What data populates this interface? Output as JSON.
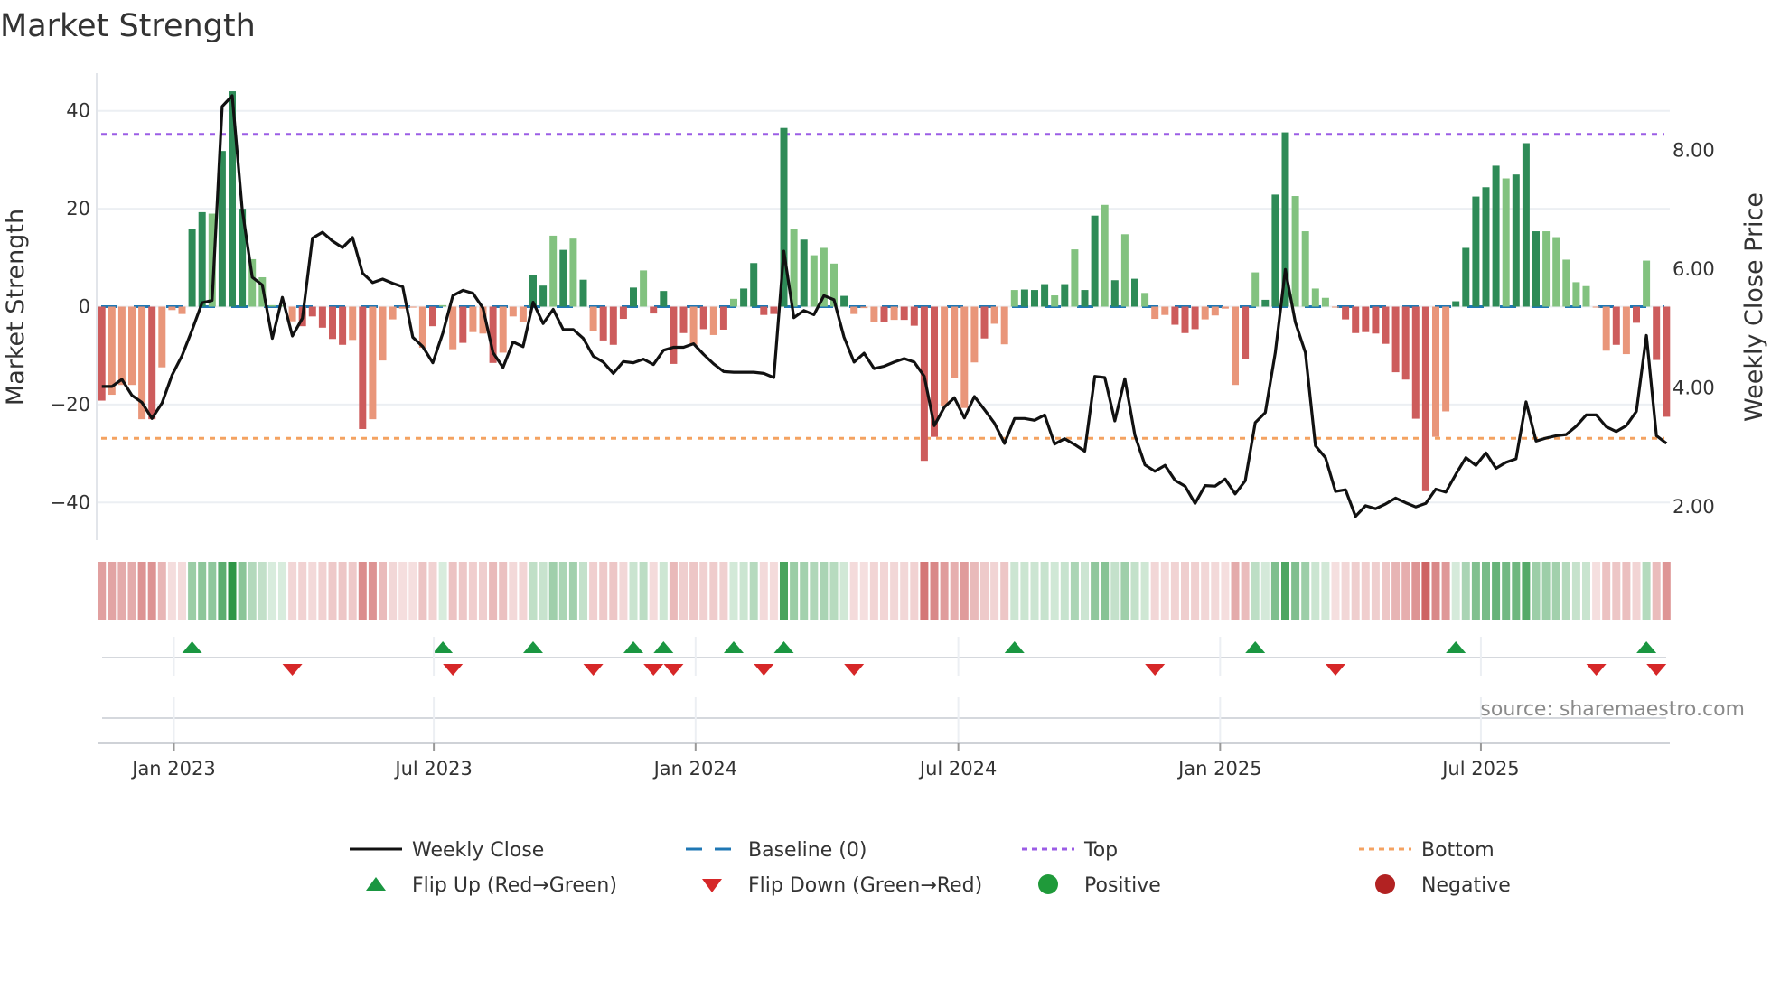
{
  "title": "Market Strength",
  "source": "source: sharemaestro.com",
  "chart_data": {
    "type": "bar+line",
    "title": "Market Strength",
    "ylabel_left": "Market Strength",
    "ylabel_right": "Weekly Close Price",
    "ylim_left": [
      -47.7,
      47.7
    ],
    "ylim_right": [
      1.42,
      9.29
    ],
    "yticks_left": [
      {
        "v": 40,
        "label": "40"
      },
      {
        "v": 20,
        "label": "20"
      },
      {
        "v": 0,
        "label": "0"
      },
      {
        "v": -20,
        "label": "−20"
      },
      {
        "v": -40,
        "label": "−40"
      }
    ],
    "yticks_right": [
      {
        "v": 8,
        "label": "8.00"
      },
      {
        "v": 6,
        "label": "6.00"
      },
      {
        "v": 4,
        "label": "4.00"
      },
      {
        "v": 2,
        "label": "2.00"
      }
    ],
    "xticks": [
      {
        "week": 7.19,
        "label": "Jan 2023"
      },
      {
        "week": 33.1,
        "label": "Jul 2023"
      },
      {
        "week": 59.2,
        "label": "Jan 2024"
      },
      {
        "week": 85.4,
        "label": "Jul 2024"
      },
      {
        "week": 111.5,
        "label": "Jan 2025"
      },
      {
        "week": 137.5,
        "label": "Jul 2025"
      }
    ],
    "top_level": 35.2,
    "bottom_level": -26.9,
    "baseline": 0,
    "strength": [
      -19.2,
      -18,
      -16,
      -16,
      -23,
      -23,
      -12.4,
      -0.7,
      -1.5,
      15.9,
      19.3,
      19,
      31.8,
      44,
      20,
      9.7,
      6,
      0.3,
      0.3,
      -3,
      -4,
      -2,
      -4.3,
      -6.6,
      -7.8,
      -6.8,
      -25,
      -23,
      -11,
      -2.6,
      -0.4,
      -0.2,
      -8.4,
      -4,
      0.3,
      -8.7,
      -7.4,
      -5.2,
      -5.5,
      -11.5,
      -9.4,
      -2,
      -3.2,
      6.4,
      4.3,
      14.5,
      11.6,
      13.9,
      5.5,
      -4.9,
      -6.9,
      -7.8,
      -2.5,
      3.9,
      7.4,
      -1.4,
      3.2,
      -11.7,
      -5.4,
      -7.8,
      -4.6,
      -5.8,
      -4.7,
      1.6,
      3.7,
      8.9,
      -1.7,
      -1.5,
      36.5,
      15.8,
      13.7,
      10.5,
      12,
      8.8,
      2.2,
      -1.5,
      -0.3,
      -3.1,
      -3.2,
      -2.7,
      -2.7,
      -3.9,
      -31.5,
      -26.6,
      -20.3,
      -14.6,
      -20.7,
      -11.4,
      -6.5,
      -3.5,
      -7.7,
      3.4,
      3.5,
      3.4,
      4.6,
      2.3,
      4.6,
      11.7,
      3.4,
      18.6,
      20.8,
      5.4,
      14.8,
      5.7,
      2.8,
      -2.5,
      -1.7,
      -3.7,
      -5.4,
      -4.6,
      -2.6,
      -1.8,
      -0.4,
      -16,
      -10.7,
      7,
      1.4,
      22.9,
      35.6,
      22.6,
      15.4,
      3.7,
      1.8,
      -0.2,
      -2.6,
      -5.4,
      -5.2,
      -5.5,
      -7.6,
      -13.4,
      -14.9,
      -22.9,
      -37.7,
      -26.6,
      -21.4,
      1.1,
      12,
      22.5,
      24.4,
      28.8,
      26.2,
      27,
      33.4,
      15.4,
      15.4,
      14.2,
      9.6,
      5,
      4.2,
      -0.2,
      -9,
      -7.8,
      -9.7,
      -3.3,
      9.4,
      -10.9,
      -22.5
    ],
    "shade": "dlllldlllddldddllllldddddldlllllldlldlldlllddldldlddddlddddldldldddddldllldllldlddddlllldllldddldlddldldllldddlllldldddllllldddddddddlldddddldddllllllldldldd",
    "weekly_close": [
      4.01,
      4.01,
      4.13,
      3.86,
      3.74,
      3.47,
      3.73,
      4.2,
      4.53,
      4.96,
      5.42,
      5.46,
      8.73,
      8.91,
      6.99,
      5.85,
      5.72,
      4.82,
      5.51,
      4.86,
      5.16,
      6.51,
      6.61,
      6.46,
      6.35,
      6.52,
      5.92,
      5.76,
      5.82,
      5.75,
      5.69,
      4.84,
      4.68,
      4.41,
      4.91,
      5.54,
      5.63,
      5.58,
      5.33,
      4.58,
      4.33,
      4.76,
      4.68,
      5.43,
      5.07,
      5.31,
      4.97,
      4.97,
      4.82,
      4.52,
      4.42,
      4.23,
      4.43,
      4.41,
      4.47,
      4.38,
      4.62,
      4.67,
      4.67,
      4.73,
      4.55,
      4.39,
      4.26,
      4.25,
      4.25,
      4.25,
      4.23,
      4.16,
      6.29,
      5.17,
      5.29,
      5.22,
      5.54,
      5.47,
      4.84,
      4.42,
      4.57,
      4.31,
      4.35,
      4.42,
      4.48,
      4.42,
      4.18,
      3.35,
      3.66,
      3.82,
      3.48,
      3.84,
      3.62,
      3.39,
      3.05,
      3.47,
      3.47,
      3.44,
      3.53,
      3.04,
      3.13,
      3.03,
      2.92,
      4.18,
      4.16,
      3.43,
      4.14,
      3.19,
      2.69,
      2.58,
      2.68,
      2.43,
      2.33,
      2.04,
      2.34,
      2.33,
      2.45,
      2.2,
      2.42,
      3.4,
      3.57,
      4.58,
      5.98,
      5.09,
      4.58,
      3.01,
      2.81,
      2.24,
      2.27,
      1.82,
      2.0,
      1.95,
      2.03,
      2.13,
      2.05,
      1.98,
      2.04,
      2.28,
      2.23,
      2.53,
      2.81,
      2.68,
      2.89,
      2.63,
      2.73,
      2.79,
      3.75,
      3.09,
      3.14,
      3.18,
      3.2,
      3.34,
      3.53,
      3.53,
      3.33,
      3.25,
      3.35,
      3.59,
      4.87,
      3.18,
      3.05
    ],
    "flip_up_weeks": [
      9,
      34,
      43,
      53,
      56,
      63,
      68,
      91,
      115,
      135,
      154
    ],
    "flip_down_weeks": [
      19,
      35,
      49,
      55,
      57,
      66,
      75,
      105,
      123,
      149,
      155
    ],
    "colors": {
      "pos_dark": "#2e8b57",
      "pos_light": "#82c27f",
      "neg_dark": "#cd5c5c",
      "neg_light": "#e9967a",
      "line": "#111111",
      "baseline": "#1f77b4",
      "top": "#9b5de5",
      "bottom": "#f4a261",
      "flip_up": "#1a9641",
      "flip_down": "#d62728",
      "positive": "#1f9a3a",
      "negative": "#b22222"
    },
    "legend": [
      {
        "key": "line",
        "label": "Weekly Close"
      },
      {
        "key": "baseline",
        "label": "Baseline (0)"
      },
      {
        "key": "top",
        "label": "Top"
      },
      {
        "key": "bottom",
        "label": "Bottom"
      },
      {
        "key": "flip_up",
        "label": "Flip Up (Red→Green)"
      },
      {
        "key": "flip_down",
        "label": "Flip Down (Green→Red)"
      },
      {
        "key": "positive",
        "label": "Positive"
      },
      {
        "key": "negative",
        "label": "Negative"
      }
    ],
    "legend_placement": "bottom"
  }
}
